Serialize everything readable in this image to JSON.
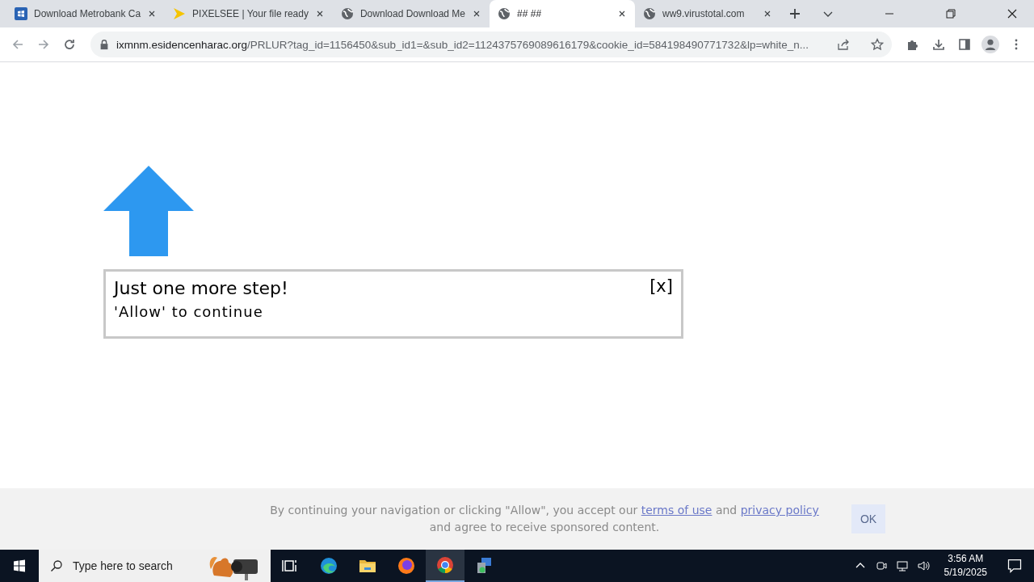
{
  "tabs": [
    {
      "title": "Download Metrobank Ca",
      "kind": "app",
      "selected": false
    },
    {
      "title": "PIXELSEE | Your file ready",
      "kind": "play",
      "selected": false
    },
    {
      "title": "Download Download Me",
      "kind": "globe",
      "selected": false
    },
    {
      "title": "## ##",
      "kind": "globe",
      "selected": true
    },
    {
      "title": "ww9.virustotal.com",
      "kind": "globe",
      "selected": false
    }
  ],
  "address_bar": {
    "host": "ixmnm.esidencenharac.org",
    "path": "/PRLUR?tag_id=1156450&sub_id1=&sub_id2=1124375769089616179&cookie_id=584198490771732&lp=white_n..."
  },
  "dialog": {
    "title": "Just one more step!",
    "message": "'Allow' to continue",
    "close": "[x]"
  },
  "consent": {
    "before": "By continuing your navigation or clicking \"Allow\", you accept our ",
    "link1": "terms of use",
    "middle": " and ",
    "link2": "privacy policy",
    "after": " and agree to receive sponsored content.",
    "button": "OK"
  },
  "taskbar": {
    "search_placeholder": "Type here to search",
    "apps": [
      {
        "kind": "taskview",
        "active": false
      },
      {
        "kind": "edge",
        "active": false
      },
      {
        "kind": "folder",
        "active": false
      },
      {
        "kind": "firefox",
        "active": false
      },
      {
        "kind": "chrome",
        "active": true
      },
      {
        "kind": "installer",
        "active": false
      }
    ],
    "time": "3:56 AM",
    "date": "5/19/2025"
  }
}
